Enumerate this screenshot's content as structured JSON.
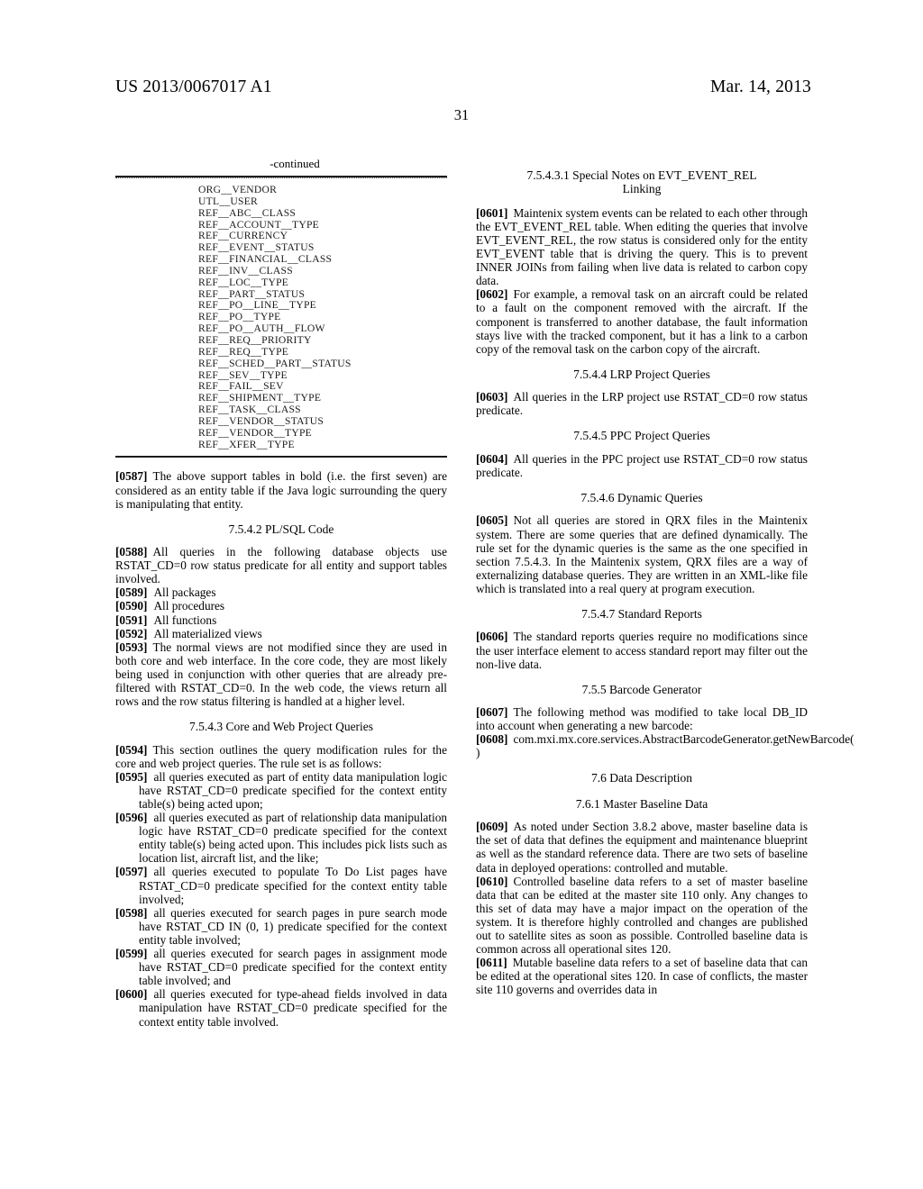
{
  "header": {
    "publication_number": "US 2013/0067017 A1",
    "publication_date": "Mar. 14, 2013",
    "page_number": "31"
  },
  "left_column": {
    "table": {
      "continued_label": "-continued",
      "rows": [
        "ORG__VENDOR",
        "UTL__USER",
        "REF__ABC__CLASS",
        "REF__ACCOUNT__TYPE",
        "REF__CURRENCY",
        "REF__EVENT__STATUS",
        "REF__FINANCIAL__CLASS",
        "REF__INV__CLASS",
        "REF__LOC__TYPE",
        "REF__PART__STATUS",
        "REF__PO__LINE__TYPE",
        "REF__PO__TYPE",
        "REF__PO__AUTH__FLOW",
        "REF__REQ__PRIORITY",
        "REF__REQ__TYPE",
        "REF__SCHED__PART__STATUS",
        "REF__SEV__TYPE",
        "REF__FAIL__SEV",
        "REF__SHIPMENT__TYPE",
        "REF__TASK__CLASS",
        "REF__VENDOR__STATUS",
        "REF__VENDOR__TYPE",
        "REF__XFER__TYPE"
      ]
    },
    "p0587": {
      "tag": "[0587]",
      "text": "The above support tables in bold (i.e. the first seven) are considered as an entity table if the Java logic surrounding the query is manipulating that entity."
    },
    "heading_7542": "7.5.4.2 PL/SQL Code",
    "p0588": {
      "tag": "[0588]",
      "text": "All queries in the following database objects use RSTAT_CD=0 row status predicate for all entity and support tables involved."
    },
    "list_objects": [
      {
        "tag": "[0589]",
        "text": "All packages"
      },
      {
        "tag": "[0590]",
        "text": "All procedures"
      },
      {
        "tag": "[0591]",
        "text": "All functions"
      },
      {
        "tag": "[0592]",
        "text": "All materialized views"
      }
    ],
    "p0593": {
      "tag": "[0593]",
      "text": "The normal views are not modified since they are used in both core and web interface. In the core code, they are most likely being used in conjunction with other queries that are already pre-filtered with RSTAT_CD=0. In the web code, the views return all rows and the row status filtering is handled at a higher level."
    },
    "heading_7543": "7.5.4.3 Core and Web Project Queries",
    "p0594": {
      "tag": "[0594]",
      "text": "This section outlines the query modification rules for the core and web project queries. The rule set is as follows:"
    },
    "rules": [
      {
        "tag": "[0595]",
        "text": "all queries executed as part of entity data manipulation logic have RSTAT_CD=0 predicate specified for the context entity table(s) being acted upon;"
      },
      {
        "tag": "[0596]",
        "text": "all queries executed as part of relationship data manipulation logic have RSTAT_CD=0 predicate specified for the context entity table(s) being acted upon. This includes pick lists such as location list, aircraft list, and the like;"
      },
      {
        "tag": "[0597]",
        "text": "all queries executed to populate To Do List pages have RSTAT_CD=0 predicate specified for the context entity table involved;"
      },
      {
        "tag": "[0598]",
        "text": "all queries executed for search pages in pure search mode have RSTAT_CD IN (0, 1) predicate specified for the context entity table involved;"
      },
      {
        "tag": "[0599]",
        "text": "all queries executed for search pages in assignment mode have RSTAT_CD=0 predicate specified for the context entity table involved; and"
      },
      {
        "tag": "[0600]",
        "text": "all queries executed for type-ahead fields involved in data manipulation have RSTAT_CD=0 predicate specified for the context entity table involved."
      }
    ]
  },
  "right_column": {
    "heading_75431_line1": "7.5.4.3.1 Special Notes on EVT_EVENT_REL",
    "heading_75431_line2": "Linking",
    "p0601": {
      "tag": "[0601]",
      "text": "Maintenix system events can be related to each other through the EVT_EVENT_REL table. When editing the queries that involve EVT_EVENT_REL, the row status is considered only for the entity EVT_EVENT table that is driving the query. This is to prevent INNER JOINs from failing when live data is related to carbon copy data."
    },
    "p0602": {
      "tag": "[0602]",
      "text": "For example, a removal task on an aircraft could be related to a fault on the component removed with the aircraft. If the component is transferred to another database, the fault information stays live with the tracked component, but it has a link to a carbon copy of the removal task on the carbon copy of the aircraft."
    },
    "heading_7544": "7.5.4.4 LRP Project Queries",
    "p0603": {
      "tag": "[0603]",
      "text": "All queries in the LRP project use RSTAT_CD=0 row status predicate."
    },
    "heading_7545": "7.5.4.5 PPC Project Queries",
    "p0604": {
      "tag": "[0604]",
      "text": "All queries in the PPC project use RSTAT_CD=0 row status predicate."
    },
    "heading_7546": "7.5.4.6 Dynamic Queries",
    "p0605": {
      "tag": "[0605]",
      "text": "Not all queries are stored in QRX files in the Maintenix system. There are some queries that are defined dynamically. The rule set for the dynamic queries is the same as the one specified in section 7.5.4.3. In the Maintenix system, QRX files are a way of externalizing database queries. They are written in an XML-like file which is translated into a real query at program execution."
    },
    "heading_7547": "7.5.4.7 Standard Reports",
    "p0606": {
      "tag": "[0606]",
      "text": "The standard reports queries require no modifications since the user interface element to access standard report may filter out the non-live data."
    },
    "heading_755": "7.5.5 Barcode Generator",
    "p0607": {
      "tag": "[0607]",
      "text": "The following method was modified to take local DB_ID into account when generating a new barcode:"
    },
    "p0608": {
      "tag": "[0608]",
      "text": "com.mxi.mx.core.services.AbstractBarcodeGenerator.getNewBarcode( )"
    },
    "heading_76": "7.6 Data Description",
    "heading_761": "7.6.1 Master Baseline Data",
    "p0609": {
      "tag": "[0609]",
      "text": "As noted under Section 3.8.2 above, master baseline data is the set of data that defines the equipment and maintenance blueprint as well as the standard reference data. There are two sets of baseline data in deployed operations: controlled and mutable."
    },
    "p0610": {
      "tag": "[0610]",
      "text": "Controlled baseline data refers to a set of master baseline data that can be edited at the master site 110 only. Any changes to this set of data may have a major impact on the operation of the system. It is therefore highly controlled and changes are published out to satellite sites as soon as possible. Controlled baseline data is common across all operational sites 120."
    },
    "p0611": {
      "tag": "[0611]",
      "text": "Mutable baseline data refers to a set of baseline data that can be edited at the operational sites 120. In case of conflicts, the master site 110 governs and overrides data in"
    }
  }
}
